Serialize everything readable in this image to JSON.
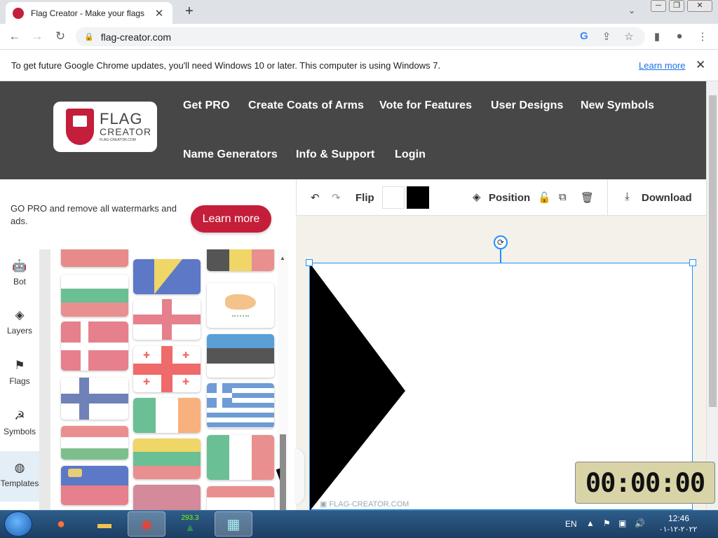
{
  "browser": {
    "tab_title": "Flag Creator - Make your flags",
    "tab_close": "✕",
    "new_tab": "+",
    "url": "flag-creator.com",
    "window_min": "─",
    "window_max": "❐",
    "window_close": "✕"
  },
  "infobar": {
    "message": "To get future Google Chrome updates, you'll need Windows 10 or later. This computer is using Windows 7.",
    "learn_more": "Learn more",
    "close": "✕"
  },
  "site": {
    "logo_line1": "FLAG",
    "logo_line2": "CREATOR",
    "logo_line3": "FLAG-CREATOR.COM",
    "nav": [
      "Get PRO",
      "Create Coats of Arms",
      "Vote for Features",
      "User Designs",
      "New Symbols",
      "Name Generators",
      "Info & Support",
      "Login"
    ]
  },
  "promo": {
    "text": "GO PRO and remove all watermarks and ads.",
    "button": "Learn more"
  },
  "sidebar": {
    "items": [
      {
        "label": "Bot",
        "icon": "bot-icon"
      },
      {
        "label": "Layers",
        "icon": "layers-icon"
      },
      {
        "label": "Flags",
        "icon": "flag-icon"
      },
      {
        "label": "Symbols",
        "icon": "hammer-sickle-icon"
      },
      {
        "label": "Templates",
        "icon": "globe-icon",
        "active": true
      }
    ]
  },
  "editor": {
    "flip": "Flip",
    "position": "Position",
    "download": "Download",
    "swatch1": "#ffffff",
    "swatch2": "#000000",
    "watermark": "FLAG-CREATOR.COM"
  },
  "clock": {
    "display": "00:00:00"
  },
  "taskbar": {
    "lang": "EN",
    "time": "12:46",
    "date": "٢٠٢٢-١٢-٠١",
    "badge": "293.3"
  },
  "flags": [
    {
      "name": "flag-partial-red",
      "colors": [
        "#e88a8a"
      ]
    },
    {
      "name": "flag-bulgaria",
      "colors": [
        "#ffffff",
        "#6bbf94",
        "#e98f8f"
      ]
    },
    {
      "name": "flag-denmark",
      "colors": [
        "#e5808c"
      ]
    },
    {
      "name": "flag-finland",
      "colors": [
        "#ffffff"
      ]
    },
    {
      "name": "flag-hungary",
      "colors": [
        "#e98f8f",
        "#ffffff",
        "#7dbf8c"
      ]
    },
    {
      "name": "flag-liechtenstein",
      "colors": [
        "#5c78c7",
        "#e5808c"
      ]
    },
    {
      "name": "flag-bosnia",
      "colors": [
        "#5c78c7"
      ]
    },
    {
      "name": "flag-england",
      "colors": [
        "#ffffff"
      ]
    },
    {
      "name": "flag-georgia",
      "colors": [
        "#ffffff"
      ]
    },
    {
      "name": "flag-ireland",
      "colors": [
        "#6bbf94",
        "#ffffff",
        "#f8b07e"
      ]
    },
    {
      "name": "flag-lithuania",
      "colors": [
        "#f0d567",
        "#6bbf94",
        "#e98f8f"
      ]
    },
    {
      "name": "flag-latvia-partial",
      "colors": [
        "#d48a9a"
      ]
    },
    {
      "name": "flag-belgium-partial",
      "colors": [
        "#555",
        "#f0d567",
        "#e98f8f"
      ]
    },
    {
      "name": "flag-cyprus",
      "colors": [
        "#ffffff"
      ]
    },
    {
      "name": "flag-estonia",
      "colors": [
        "#5a9fd6",
        "#555555",
        "#ffffff"
      ]
    },
    {
      "name": "flag-greece",
      "colors": [
        "#6f9bd6",
        "#ffffff"
      ]
    },
    {
      "name": "flag-italy",
      "colors": [
        "#6bbf94",
        "#ffffff",
        "#e98f8f"
      ]
    },
    {
      "name": "flag-partial-bottom",
      "colors": [
        "#e98f8f"
      ]
    }
  ]
}
